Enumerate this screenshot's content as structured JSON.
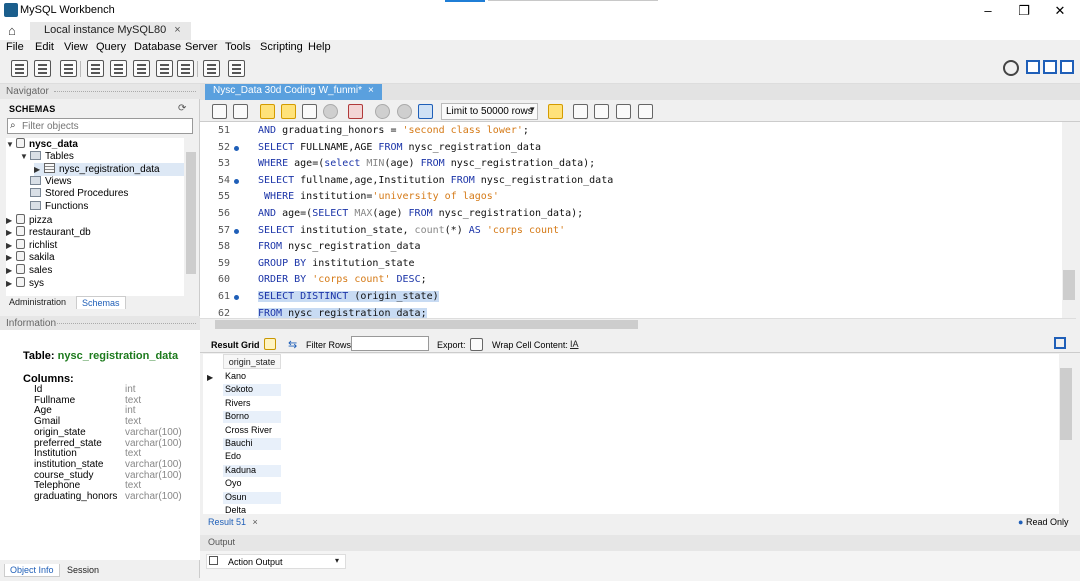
{
  "window": {
    "title": "MySQL Workbench",
    "minimize": "–",
    "maximize": "❐",
    "close": "✕"
  },
  "connection_tab": {
    "label": "Local instance MySQL80",
    "close": "×"
  },
  "menu": [
    "File",
    "Edit",
    "View",
    "Query",
    "Database",
    "Server",
    "Tools",
    "Scripting",
    "Help"
  ],
  "navigator": {
    "header": "Navigator",
    "schemas_label": "SCHEMAS",
    "filter_placeholder": "Filter objects",
    "tree": [
      {
        "label": "nysc_data",
        "level": 0,
        "expanded": true,
        "bold": true,
        "kind": "db"
      },
      {
        "label": "Tables",
        "level": 1,
        "expanded": true,
        "kind": "folder"
      },
      {
        "label": "nysc_registration_data",
        "level": 2,
        "expanded": false,
        "kind": "table",
        "selected": true
      },
      {
        "label": "Views",
        "level": 1,
        "kind": "folder"
      },
      {
        "label": "Stored Procedures",
        "level": 1,
        "kind": "folder"
      },
      {
        "label": "Functions",
        "level": 1,
        "kind": "folder"
      },
      {
        "label": "pizza",
        "level": 0,
        "kind": "db"
      },
      {
        "label": "restaurant_db",
        "level": 0,
        "kind": "db"
      },
      {
        "label": "richlist",
        "level": 0,
        "kind": "db"
      },
      {
        "label": "sakila",
        "level": 0,
        "kind": "db"
      },
      {
        "label": "sales",
        "level": 0,
        "kind": "db"
      },
      {
        "label": "sys",
        "level": 0,
        "kind": "db"
      }
    ],
    "tabs": [
      "Administration",
      "Schemas"
    ]
  },
  "information": {
    "header": "Information",
    "table_prefix": "Table:",
    "table_name": "nysc_registration_data",
    "columns_label": "Columns:",
    "columns": [
      {
        "name": "Id",
        "type": "int"
      },
      {
        "name": "Fullname",
        "type": "text"
      },
      {
        "name": "Age",
        "type": "int"
      },
      {
        "name": "Gmail",
        "type": "text"
      },
      {
        "name": "origin_state",
        "type": "varchar(100)"
      },
      {
        "name": "preferred_state",
        "type": "varchar(100)"
      },
      {
        "name": "Institution",
        "type": "text"
      },
      {
        "name": "institution_state",
        "type": "varchar(100)"
      },
      {
        "name": "course_study",
        "type": "varchar(100)"
      },
      {
        "name": "Telephone",
        "type": "text"
      },
      {
        "name": "graduating_honors",
        "type": "varchar(100)"
      }
    ],
    "bottom_tabs": [
      "Object Info",
      "Session"
    ]
  },
  "editor": {
    "tab_label": "Nysc_Data 30d Coding W_funmi*",
    "tab_close": "×",
    "limit_label": "Limit to 50000 rows",
    "lines": [
      {
        "num": "51",
        "dot": false,
        "html": "<span class=\"kw\">AND</span> graduating_honors = <span class=\"str\">'second class lower'</span>;"
      },
      {
        "num": "52",
        "dot": true,
        "html": "<span class=\"kw\">SELECT</span> FULLNAME,AGE <span class=\"kw\">FROM</span> nysc_registration_data"
      },
      {
        "num": "53",
        "dot": false,
        "html": "<span class=\"kw\">WHERE</span> age=(<span class=\"kw\">select</span> <span class=\"fn\">MIN</span>(age) <span class=\"kw\">FROM</span> nysc_registration_data);"
      },
      {
        "num": "54",
        "dot": true,
        "html": "<span class=\"kw\">SELECT</span> fullname,age,Institution <span class=\"kw\">FROM</span> nysc_registration_data"
      },
      {
        "num": "55",
        "dot": false,
        "html": " <span class=\"kw\">WHERE</span> institution=<span class=\"str\">'university of lagos'</span>"
      },
      {
        "num": "56",
        "dot": false,
        "html": "<span class=\"kw\">AND</span> age=(<span class=\"kw\">SELECT</span> <span class=\"fn\">MAX</span>(age) <span class=\"kw\">FROM</span> nysc_registration_data);"
      },
      {
        "num": "57",
        "dot": true,
        "html": "<span class=\"kw\">SELECT</span> institution_state, <span class=\"fn\">count</span>(*) <span class=\"kw\">AS</span> <span class=\"str\">'corps count'</span>"
      },
      {
        "num": "58",
        "dot": false,
        "html": "<span class=\"kw\">FROM</span> nysc_registration_data"
      },
      {
        "num": "59",
        "dot": false,
        "html": "<span class=\"kw\">GROUP BY</span> institution_state"
      },
      {
        "num": "60",
        "dot": false,
        "html": "<span class=\"kw\">ORDER BY</span> <span class=\"str\">'corps count'</span> <span class=\"kw\">DESC</span>;"
      },
      {
        "num": "61",
        "dot": true,
        "html": "<span class=\"hl\"><span class=\"kw\">SELECT DISTINCT</span> (origin_state)</span>"
      },
      {
        "num": "62",
        "dot": false,
        "html": "<span class=\"hl\"><span class=\"kw\">FROM</span> nysc_registration_data;</span>"
      }
    ]
  },
  "result": {
    "grid_label": "Result Grid",
    "filter_label": "Filter Rows:",
    "export_label": "Export:",
    "wrap_label": "Wrap Cell Content:",
    "column_header": "origin_state",
    "rows": [
      "Kano",
      "Sokoto",
      "Rivers",
      "Borno",
      "Cross River",
      "Bauchi",
      "Edo",
      "Kaduna",
      "Oyo",
      "Osun",
      "Delta"
    ],
    "tab_label": "Result 51",
    "tab_close": "×",
    "read_only": "Read Only"
  },
  "output": {
    "header": "Output",
    "selector": "Action Output"
  }
}
